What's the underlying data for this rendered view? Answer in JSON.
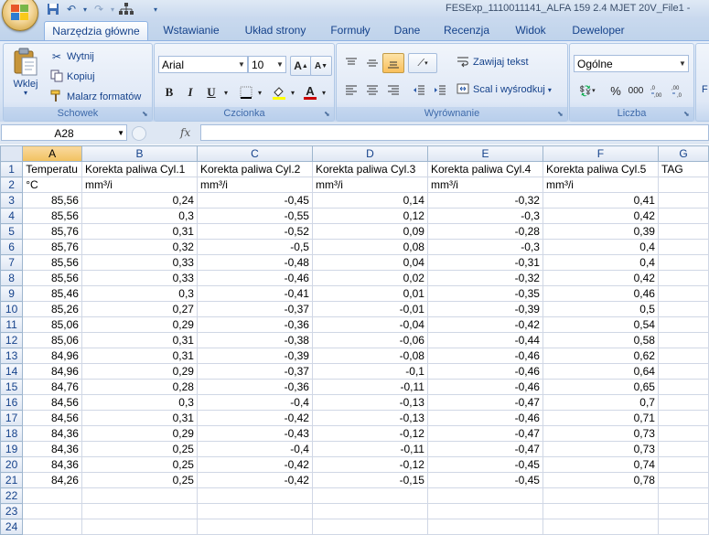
{
  "window": {
    "title": "FESExp_1110011141_ALFA 159 2.4 MJET 20V_File1 -"
  },
  "quick_access": {
    "items": [
      "save-icon",
      "undo-icon",
      "redo-icon",
      "diagram-icon",
      "customize-icon"
    ]
  },
  "tabs": [
    "Narzędzia główne",
    "Wstawianie",
    "Układ strony",
    "Formuły",
    "Dane",
    "Recenzja",
    "Widok",
    "Deweloper"
  ],
  "ribbon": {
    "clipboard": {
      "label": "Schowek",
      "paste": "Wklej",
      "cut": "Wytnij",
      "copy": "Kopiuj",
      "format_painter": "Malarz formatów"
    },
    "font": {
      "label": "Czcionka",
      "font_name": "Arial",
      "font_size": "10",
      "bold": "B",
      "italic": "I",
      "underline": "U",
      "font_color": "#cc0000",
      "fill_color": "#ffff00"
    },
    "alignment": {
      "label": "Wyrównanie",
      "wrap_text": "Zawijaj tekst",
      "merge_center": "Scal i wyśrodkuj"
    },
    "number": {
      "label": "Liczba",
      "format": "Ogólne",
      "percent": "%",
      "thousands": "000"
    },
    "overflow": "F"
  },
  "formula_bar": {
    "name_box": "A28",
    "fx": "fx",
    "content": ""
  },
  "sheet": {
    "columns": [
      "A",
      "B",
      "C",
      "D",
      "E",
      "F",
      "G"
    ],
    "selected_column": "A",
    "rows": [
      {
        "n": "1",
        "cells": [
          "Temperatu",
          "Korekta paliwa Cyl.1",
          "Korekta paliwa Cyl.2",
          "Korekta paliwa Cyl.3",
          "Korekta paliwa Cyl.4",
          "Korekta paliwa Cyl.5",
          "TAG"
        ],
        "kind": "text"
      },
      {
        "n": "2",
        "cells": [
          "°C",
          "mm³/i",
          "mm³/i",
          "mm³/i",
          "mm³/i",
          "mm³/i",
          ""
        ],
        "kind": "text"
      },
      {
        "n": "3",
        "cells": [
          "85,56",
          "0,24",
          "-0,45",
          "0,14",
          "-0,32",
          "0,41",
          ""
        ],
        "kind": "num"
      },
      {
        "n": "4",
        "cells": [
          "85,56",
          "0,3",
          "-0,55",
          "0,12",
          "-0,3",
          "0,42",
          ""
        ],
        "kind": "num"
      },
      {
        "n": "5",
        "cells": [
          "85,76",
          "0,31",
          "-0,52",
          "0,09",
          "-0,28",
          "0,39",
          ""
        ],
        "kind": "num"
      },
      {
        "n": "6",
        "cells": [
          "85,76",
          "0,32",
          "-0,5",
          "0,08",
          "-0,3",
          "0,4",
          ""
        ],
        "kind": "num"
      },
      {
        "n": "7",
        "cells": [
          "85,56",
          "0,33",
          "-0,48",
          "0,04",
          "-0,31",
          "0,4",
          ""
        ],
        "kind": "num"
      },
      {
        "n": "8",
        "cells": [
          "85,56",
          "0,33",
          "-0,46",
          "0,02",
          "-0,32",
          "0,42",
          ""
        ],
        "kind": "num"
      },
      {
        "n": "9",
        "cells": [
          "85,46",
          "0,3",
          "-0,41",
          "0,01",
          "-0,35",
          "0,46",
          ""
        ],
        "kind": "num"
      },
      {
        "n": "10",
        "cells": [
          "85,26",
          "0,27",
          "-0,37",
          "-0,01",
          "-0,39",
          "0,5",
          ""
        ],
        "kind": "num"
      },
      {
        "n": "11",
        "cells": [
          "85,06",
          "0,29",
          "-0,36",
          "-0,04",
          "-0,42",
          "0,54",
          ""
        ],
        "kind": "num"
      },
      {
        "n": "12",
        "cells": [
          "85,06",
          "0,31",
          "-0,38",
          "-0,06",
          "-0,44",
          "0,58",
          ""
        ],
        "kind": "num"
      },
      {
        "n": "13",
        "cells": [
          "84,96",
          "0,31",
          "-0,39",
          "-0,08",
          "-0,46",
          "0,62",
          ""
        ],
        "kind": "num"
      },
      {
        "n": "14",
        "cells": [
          "84,96",
          "0,29",
          "-0,37",
          "-0,1",
          "-0,46",
          "0,64",
          ""
        ],
        "kind": "num"
      },
      {
        "n": "15",
        "cells": [
          "84,76",
          "0,28",
          "-0,36",
          "-0,11",
          "-0,46",
          "0,65",
          ""
        ],
        "kind": "num"
      },
      {
        "n": "16",
        "cells": [
          "84,56",
          "0,3",
          "-0,4",
          "-0,13",
          "-0,47",
          "0,7",
          ""
        ],
        "kind": "num"
      },
      {
        "n": "17",
        "cells": [
          "84,56",
          "0,31",
          "-0,42",
          "-0,13",
          "-0,46",
          "0,71",
          ""
        ],
        "kind": "num"
      },
      {
        "n": "18",
        "cells": [
          "84,36",
          "0,29",
          "-0,43",
          "-0,12",
          "-0,47",
          "0,73",
          ""
        ],
        "kind": "num"
      },
      {
        "n": "19",
        "cells": [
          "84,36",
          "0,25",
          "-0,4",
          "-0,11",
          "-0,47",
          "0,73",
          ""
        ],
        "kind": "num"
      },
      {
        "n": "20",
        "cells": [
          "84,36",
          "0,25",
          "-0,42",
          "-0,12",
          "-0,45",
          "0,74",
          ""
        ],
        "kind": "num"
      },
      {
        "n": "21",
        "cells": [
          "84,26",
          "0,25",
          "-0,42",
          "-0,15",
          "-0,45",
          "0,78",
          ""
        ],
        "kind": "num"
      },
      {
        "n": "22",
        "cells": [
          "",
          "",
          "",
          "",
          "",
          "",
          ""
        ],
        "kind": "num"
      },
      {
        "n": "23",
        "cells": [
          "",
          "",
          "",
          "",
          "",
          "",
          ""
        ],
        "kind": "num"
      },
      {
        "n": "24",
        "cells": [
          "",
          "",
          "",
          "",
          "",
          "",
          ""
        ],
        "kind": "num"
      }
    ]
  }
}
